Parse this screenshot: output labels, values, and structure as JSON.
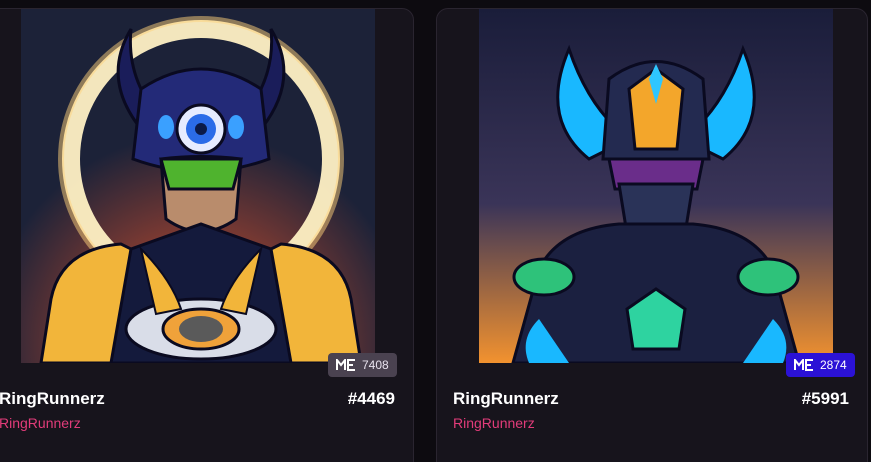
{
  "cards": [
    {
      "name": "RingRunnerz",
      "collection": "RingRunnerz",
      "token_id": "#4469",
      "badge_value": "7408",
      "badge_color": "#4a4250"
    },
    {
      "name": "RingRunnerz",
      "collection": "RingRunnerz",
      "token_id": "#5991",
      "badge_value": "2874",
      "badge_color": "#2b12d6"
    }
  ],
  "colors": {
    "background": "#0d0b10",
    "card": "#17141c",
    "collection_text": "#e23c7a"
  },
  "icons": {
    "badge_icon": "magic-eden-logo"
  }
}
